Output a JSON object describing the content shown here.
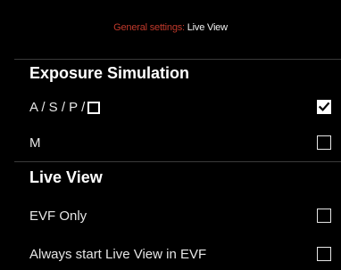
{
  "header": {
    "parent": "General settings:",
    "current": "Live View"
  },
  "sections": [
    {
      "title": "Exposure Simulation",
      "items": [
        {
          "label": "A / S / P /",
          "trailing_icon": "square-icon",
          "checked": true
        },
        {
          "label": "M",
          "checked": false
        }
      ]
    },
    {
      "title": "Live View",
      "items": [
        {
          "label": "EVF Only",
          "checked": false
        },
        {
          "label": "Always start Live View in EVF",
          "checked": false
        }
      ]
    }
  ],
  "colors": {
    "background": "#000000",
    "breadcrumb_parent": "#c0392b",
    "text": "#ffffff"
  }
}
